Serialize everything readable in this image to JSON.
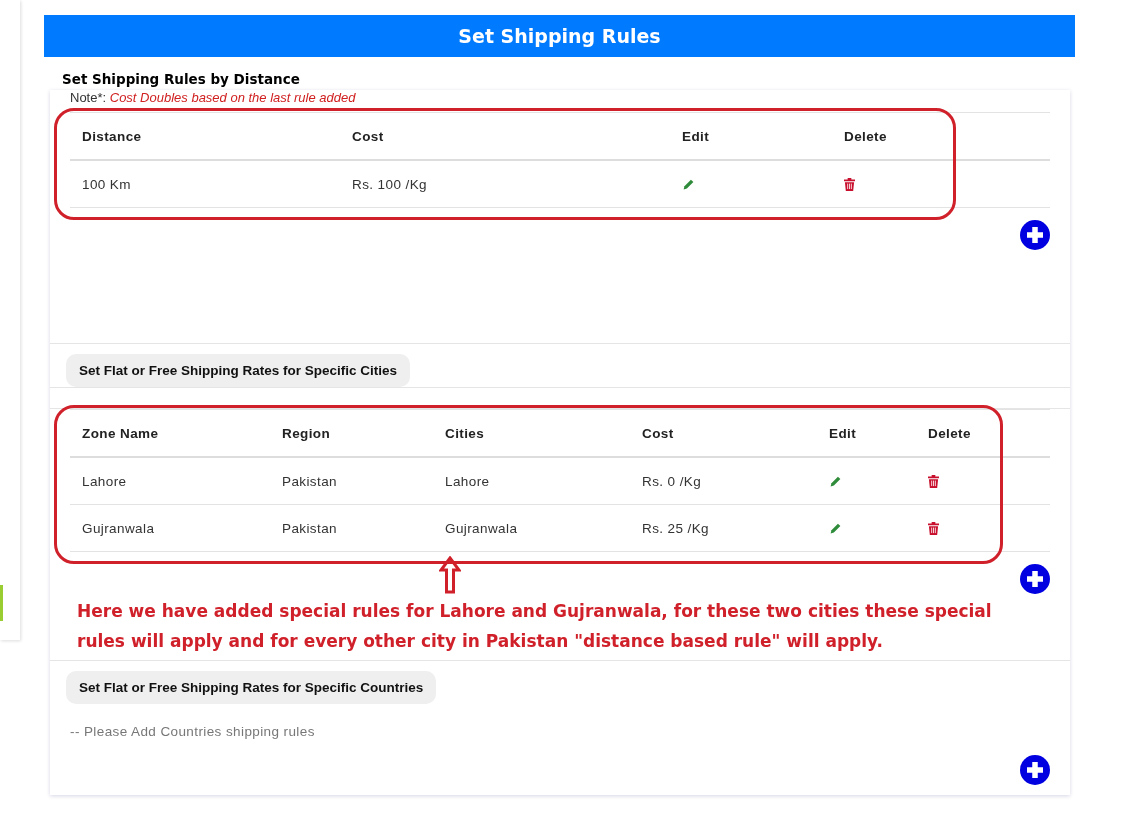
{
  "header": {
    "title": "Set Shipping Rules"
  },
  "distance_section": {
    "title": "Set Shipping Rules by Distance",
    "note_label": "Note*:",
    "note": "Cost Doubles based on the last rule added",
    "table": {
      "highlighted": true,
      "columns": [
        "Distance",
        "Cost",
        "Edit",
        "Delete"
      ],
      "rows": [
        {
          "cells": [
            {
              "kind": "text",
              "text": "100 Km"
            },
            {
              "kind": "text",
              "text": "Rs. 100 /Kg"
            },
            {
              "kind": "edit"
            },
            {
              "kind": "delete"
            }
          ]
        }
      ]
    }
  },
  "cities_section": {
    "button": "Set Flat or Free Shipping Rates for Specific Cities",
    "table": {
      "highlighted": true,
      "columns": [
        "Zone Name",
        "Region",
        "Cities",
        "Cost",
        "Edit",
        "Delete"
      ],
      "rows": [
        {
          "cells": [
            {
              "kind": "text",
              "text": "Lahore"
            },
            {
              "kind": "text",
              "text": "Pakistan"
            },
            {
              "kind": "text",
              "text": "Lahore"
            },
            {
              "kind": "text",
              "text": "Rs. 0 /Kg"
            },
            {
              "kind": "edit"
            },
            {
              "kind": "delete"
            }
          ]
        },
        {
          "cells": [
            {
              "kind": "text",
              "text": "Gujranwala"
            },
            {
              "kind": "text",
              "text": "Pakistan"
            },
            {
              "kind": "text",
              "text": "Gujranwala"
            },
            {
              "kind": "text",
              "text": "Rs. 25 /Kg"
            },
            {
              "kind": "edit"
            },
            {
              "kind": "delete"
            }
          ]
        }
      ]
    },
    "annotation": "Here we have added special rules for Lahore and Gujranwala,  for these two cities these special rules will apply and for every other city in Pakistan \"distance based rule\" will apply."
  },
  "countries_section": {
    "button": "Set Flat or Free Shipping Rates for Specific Countries",
    "empty_text": "-- Please Add Countries shipping rules"
  }
}
